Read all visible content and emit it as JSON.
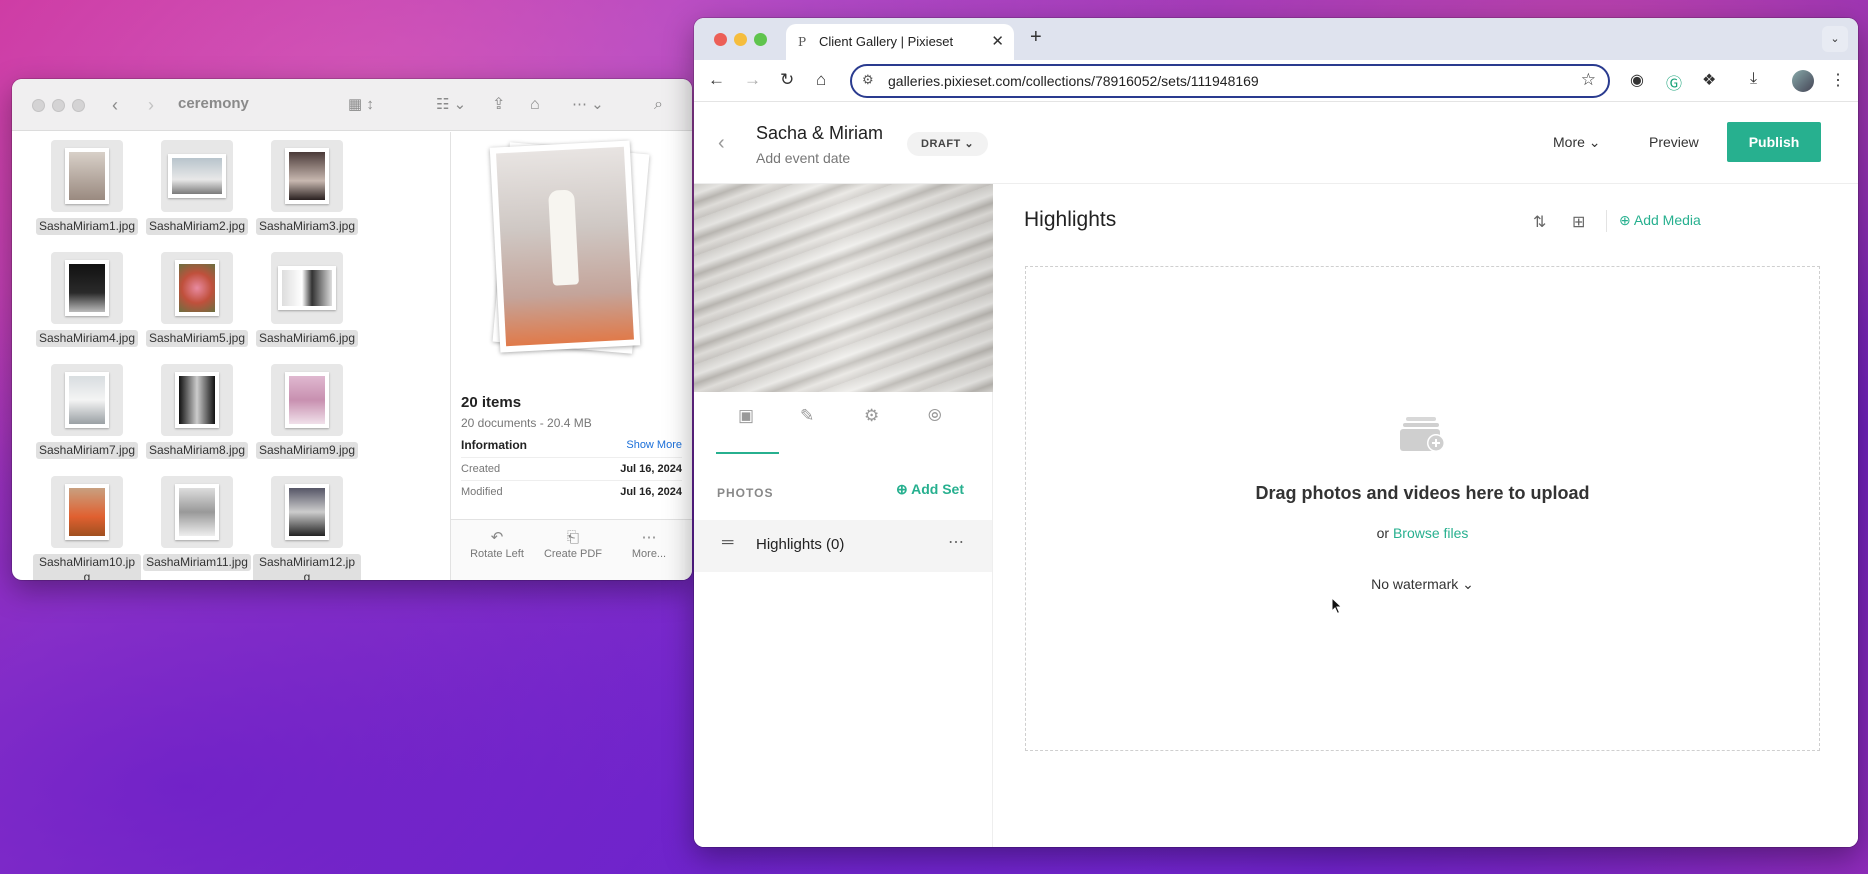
{
  "finder": {
    "title": "ceremony",
    "files": [
      {
        "name": "SashaMiriam1.jpg"
      },
      {
        "name": "SashaMiriam2.jpg"
      },
      {
        "name": "SashaMiriam3.jpg"
      },
      {
        "name": "SashaMiriam4.jpg"
      },
      {
        "name": "SashaMiriam5.jpg"
      },
      {
        "name": "SashaMiriam6.jpg"
      },
      {
        "name": "SashaMiriam7.jpg"
      },
      {
        "name": "SashaMiriam8.jpg"
      },
      {
        "name": "SashaMiriam9.jpg"
      },
      {
        "name": "SashaMiriam10.jpg"
      },
      {
        "name": "SashaMiriam11.jpg"
      },
      {
        "name": "SashaMiriam12.jpg"
      }
    ],
    "summary": {
      "items": "20 items",
      "sub": "20 documents - 20.4 MB",
      "information": "Information",
      "show_more": "Show More",
      "created_label": "Created",
      "created_value": "Jul 16, 2024",
      "modified_label": "Modified",
      "modified_value": "Jul 16, 2024"
    },
    "actions": {
      "rotate": "Rotate Left",
      "pdf": "Create PDF",
      "more": "More..."
    }
  },
  "browser": {
    "tab_title": "Client Gallery | Pixieset",
    "tab_favicon": "P",
    "url": "galleries.pixieset.com/collections/78916052/sets/111948169"
  },
  "app": {
    "gallery_name": "Sacha & Miriam",
    "event_date": "Add event date",
    "status": "DRAFT",
    "more": "More",
    "preview": "Preview",
    "publish": "Publish",
    "photos_label": "PHOTOS",
    "add_set": "Add Set",
    "set_name": "Highlights (0)",
    "main_title": "Highlights",
    "add_media": "Add Media",
    "drop_title": "Drag photos and videos here to upload",
    "or": "or",
    "browse": "Browse files",
    "watermark": "No watermark"
  },
  "colors": {
    "accent": "#27b08f"
  }
}
